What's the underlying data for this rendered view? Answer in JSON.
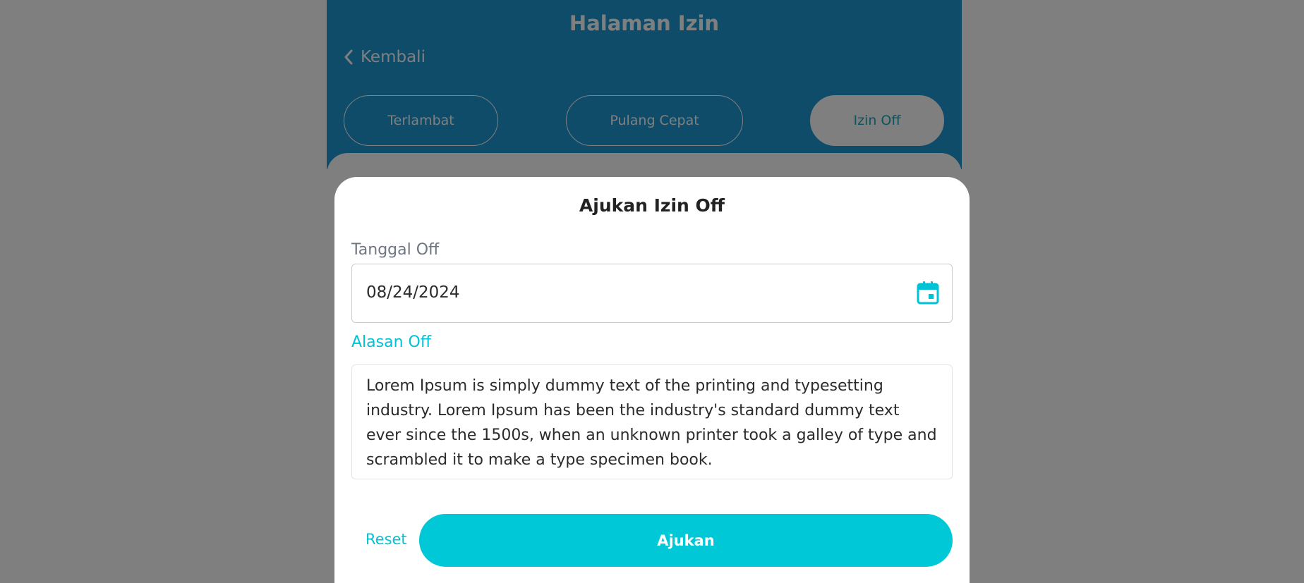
{
  "app": {
    "title": "Halaman Izin",
    "back_label": "Kembali",
    "tabs": [
      {
        "label": "Terlambat",
        "active": false
      },
      {
        "label": "Pulang Cepat",
        "active": false
      },
      {
        "label": "Izin Off",
        "active": true
      }
    ]
  },
  "modal": {
    "title": "Ajukan Izin Off",
    "date_label": "Tanggal Off",
    "date_value": "08/24/2024",
    "reason_label": "Alasan Off",
    "reason_value": "Lorem Ipsum is simply dummy text of the printing and typesetting industry. Lorem Ipsum has been the industry's standard dummy text ever since the 1500s, when an unknown printer took a galley of type and scrambled it to make a type specimen book.",
    "reset_label": "Reset",
    "submit_label": "Ajukan"
  },
  "icons": {
    "back": "chevron-left-icon",
    "calendar": "calendar-icon"
  },
  "colors": {
    "header": "#1d99d4",
    "accent": "#00c8d7",
    "overlay": "rgba(0,0,0,0.5)"
  }
}
